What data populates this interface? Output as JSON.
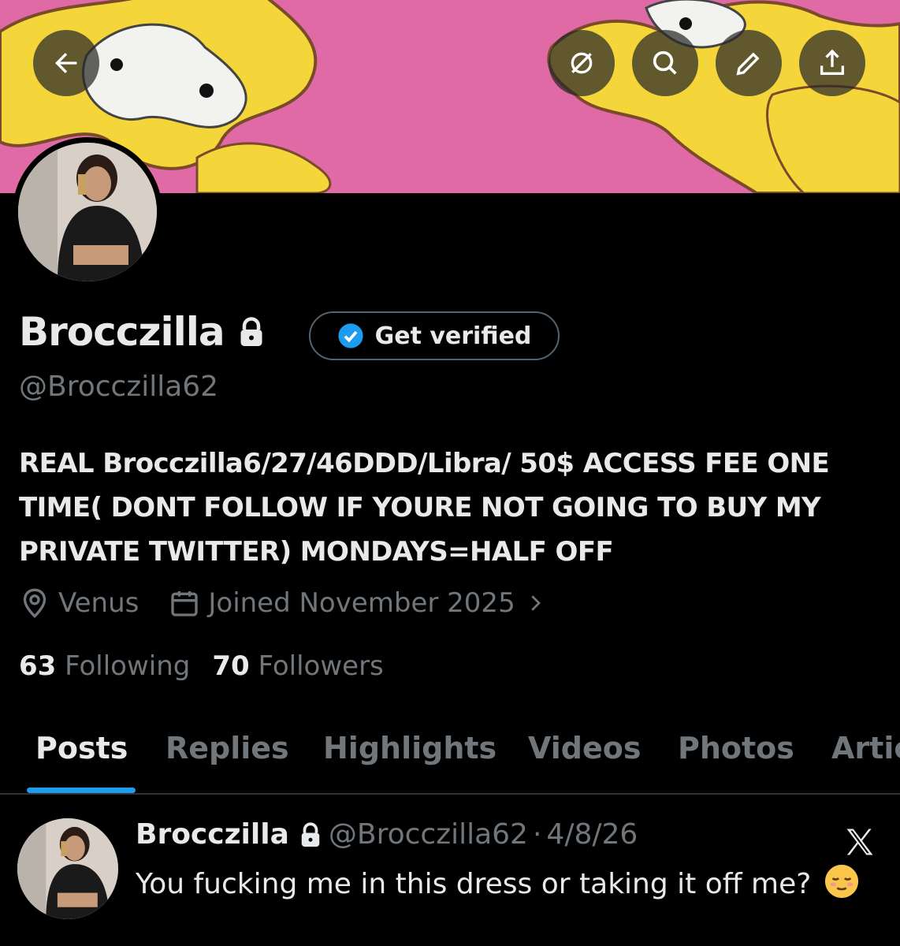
{
  "header": {
    "back_icon": "arrow-left-icon",
    "actions": [
      "grok-icon",
      "search-icon",
      "edit-icon",
      "share-icon"
    ]
  },
  "profile": {
    "name": "Brocczilla",
    "handle": "@Brocczilla62",
    "verify_button": "Get verified",
    "bio": "REAL Brocczilla6/27/46DDD/Libra/ 50$ ACCESS FEE ONE TIME( DONT FOLLOW IF YOURE NOT GOING TO BUY MY PRIVATE TWITTER) MONDAYS=HALF OFF",
    "location": "Venus",
    "joined": "Joined November 2025",
    "following_count": "63",
    "following_label": "Following",
    "followers_count": "70",
    "followers_label": "Followers"
  },
  "tabs": [
    "Posts",
    "Replies",
    "Highlights",
    "Videos",
    "Photos",
    "Artic"
  ],
  "active_tab": "Posts",
  "post": {
    "name": "Brocczilla",
    "handle": "@Brocczilla62",
    "separator": "·",
    "date": "4/8/26",
    "text": "You fucking me in this dress or taking it off me?"
  },
  "colors": {
    "background": "#000000",
    "text": "#e7e9ea",
    "muted": "#71767b",
    "accent": "#1d9bf0",
    "banner_pink": "#e06aa6",
    "banner_yellow": "#f4d63a"
  }
}
